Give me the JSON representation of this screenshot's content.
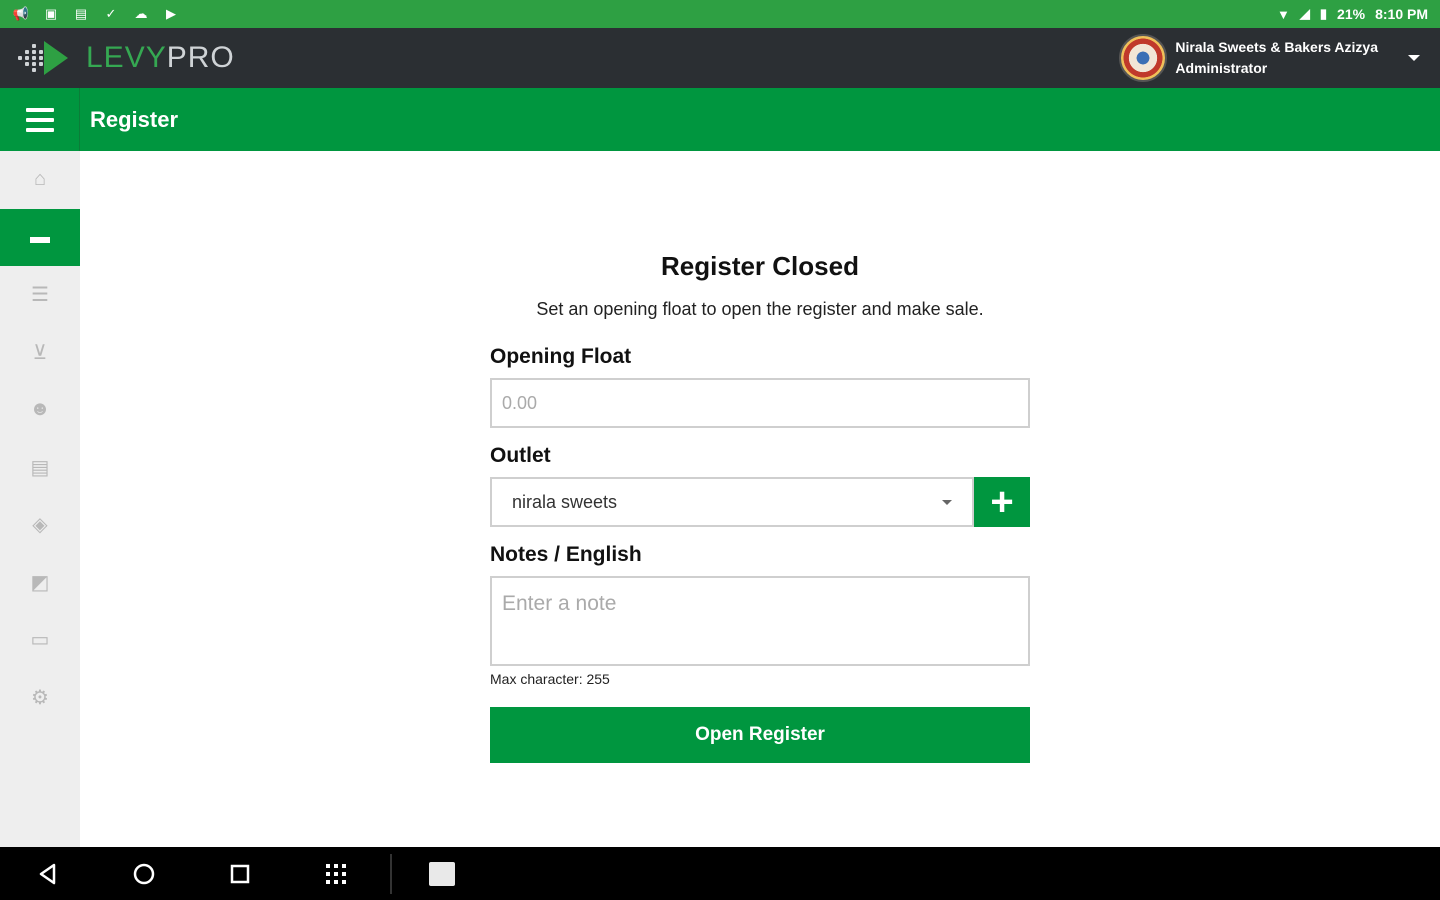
{
  "status_bar": {
    "left_icons": [
      "megaphone-icon",
      "photo-icon",
      "save-icon",
      "check-icon",
      "cloud-icon",
      "play-store-icon"
    ],
    "battery": "21%",
    "time": "8:10 PM"
  },
  "header": {
    "logo_levy": "LEVY",
    "logo_pro": "PRO",
    "user_name": "Nirala Sweets & Bakers Azizya",
    "user_role": "Administrator"
  },
  "title_bar": {
    "title": "Register"
  },
  "sidebar": {
    "items": [
      {
        "name": "home",
        "icon": "home-icon",
        "active": false
      },
      {
        "name": "register",
        "icon": "cash-register-icon",
        "active": true
      },
      {
        "name": "database",
        "icon": "database-icon",
        "active": false
      },
      {
        "name": "cart",
        "icon": "cart-icon",
        "active": false
      },
      {
        "name": "customers",
        "icon": "users-icon",
        "active": false
      },
      {
        "name": "reports",
        "icon": "report-icon",
        "active": false
      },
      {
        "name": "products",
        "icon": "box-icon",
        "active": false
      },
      {
        "name": "messages",
        "icon": "chat-icon",
        "active": false
      },
      {
        "name": "payments",
        "icon": "money-icon",
        "active": false
      },
      {
        "name": "settings",
        "icon": "gear-icon",
        "active": false
      }
    ]
  },
  "form": {
    "title": "Register Closed",
    "subtitle": "Set an opening float to open the register and make sale.",
    "opening_float_label": "Opening Float",
    "opening_float_placeholder": "0.00",
    "outlet_label": "Outlet",
    "outlet_value": "nirala sweets",
    "add_outlet_symbol": "+",
    "notes_label": "Notes / English",
    "notes_placeholder": "Enter a note",
    "max_char_hint": "Max character: 255",
    "submit_label": "Open Register"
  },
  "nav_bar": {
    "back": "◁",
    "home": "○",
    "recents": "□",
    "apps": "⁝⁝⁝"
  },
  "colors": {
    "status_green": "#2ea043",
    "header_dark": "#2b2f33",
    "brand_green": "#00963f"
  }
}
